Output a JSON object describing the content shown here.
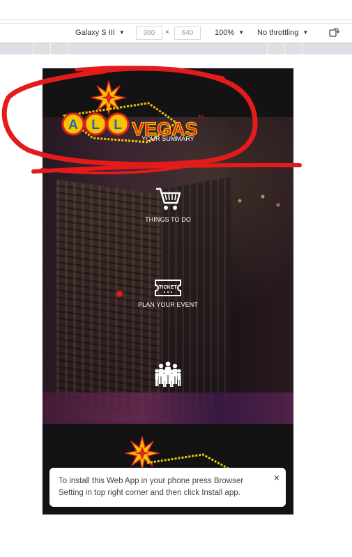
{
  "devtools": {
    "device": "Galaxy S III",
    "width": "360",
    "height": "640",
    "dim_separator": "×",
    "zoom": "100%",
    "throttling": "No throttling"
  },
  "app": {
    "logo_letters": [
      "A",
      "L",
      "L"
    ],
    "logo_word": "VEGAS",
    "logo_tm": "TM",
    "menu": [
      {
        "label": "YOUR SUMMARY",
        "icon": "summary-icon"
      },
      {
        "label": "THINGS TO DO",
        "icon": "cart-icon"
      },
      {
        "label": "PLAN YOUR EVENT",
        "icon": "ticket-icon"
      },
      {
        "label": "",
        "icon": "group-people-icon"
      }
    ],
    "ticket_text": "TICKET"
  },
  "toast": {
    "message": "To install this Web App in your phone press Browser Setting in top right corner and then click Install app.",
    "close": "×"
  },
  "colors": {
    "annotation_red": "#e41b1b",
    "logo_yellow": "#f5c400",
    "logo_red": "#e0231b"
  }
}
